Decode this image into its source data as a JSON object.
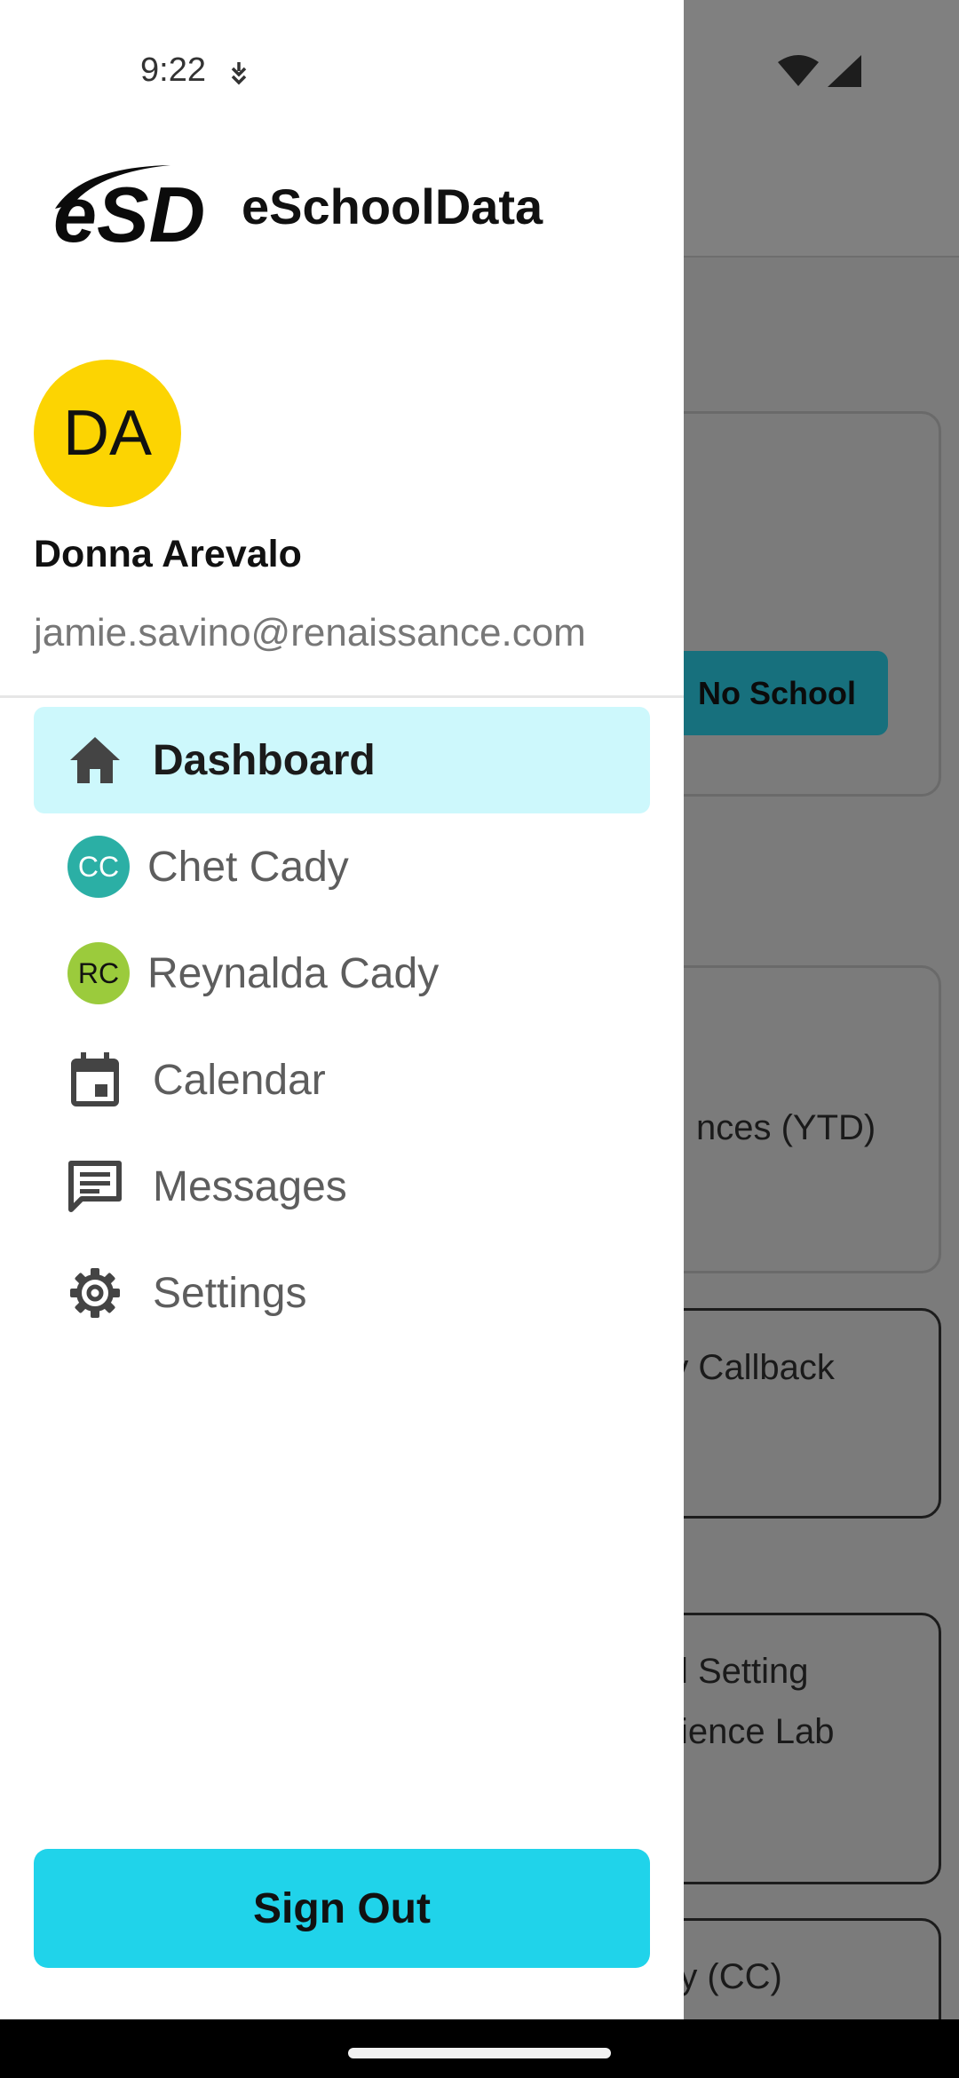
{
  "status_bar": {
    "time": "9:22"
  },
  "app": {
    "name": "eSchoolData",
    "logo_text": "eSD"
  },
  "user": {
    "initials": "DA",
    "name": "Donna Arevalo",
    "email": "jamie.savino@renaissance.com",
    "avatar_color": "#FCD402"
  },
  "nav": {
    "items": [
      {
        "label": "Dashboard",
        "icon": "home-icon",
        "active": true
      },
      {
        "label": "Chet Cady",
        "initials": "CC",
        "avatar_color": "#2BAFA5"
      },
      {
        "label": "Reynalda Cady",
        "initials": "RC",
        "avatar_color": "#9BCB3C"
      },
      {
        "label": "Calendar",
        "icon": "calendar-icon"
      },
      {
        "label": "Messages",
        "icon": "message-icon"
      },
      {
        "label": "Settings",
        "icon": "gear-icon"
      }
    ],
    "active_color": "#CDF8FC"
  },
  "sign_out": {
    "label": "Sign Out",
    "color": "#20D3EA"
  },
  "background": {
    "chip_label": "No School",
    "card2_text": "nces (YTD)",
    "card3_text": "ry Callback",
    "card4_line1": "l Setting",
    "card4_line2": "ience Lab",
    "card5_text": "ry (CC)"
  }
}
